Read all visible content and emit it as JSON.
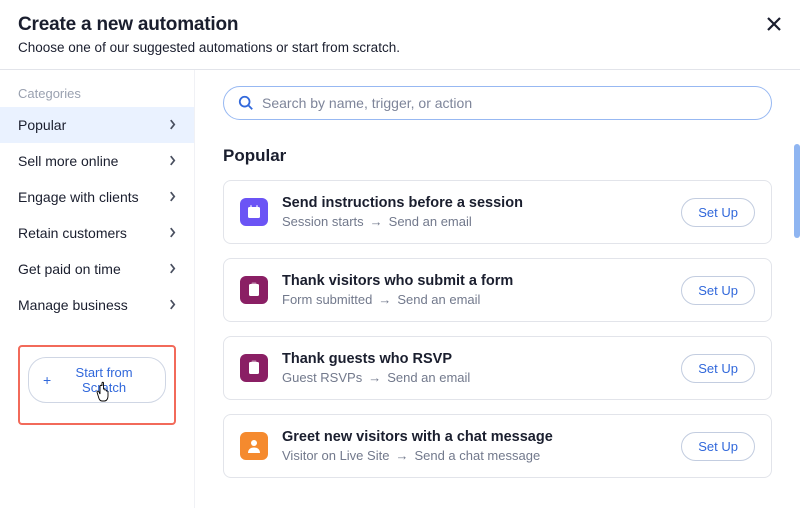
{
  "header": {
    "title": "Create a new automation",
    "subtitle": "Choose one of our suggested automations or start from scratch."
  },
  "sidebar": {
    "header": "Categories",
    "items": [
      {
        "label": "Popular",
        "active": true
      },
      {
        "label": "Sell more online"
      },
      {
        "label": "Engage with clients"
      },
      {
        "label": "Retain customers"
      },
      {
        "label": "Get paid on time"
      },
      {
        "label": "Manage business"
      }
    ],
    "scratch_label": "Start from Scratch"
  },
  "search": {
    "placeholder": "Search by name, trigger, or action",
    "value": ""
  },
  "section": {
    "title": "Popular"
  },
  "cards": [
    {
      "title": "Send instructions before a session",
      "trigger": "Session starts",
      "action": "Send an email",
      "setup": "Set Up",
      "color": "#6b54f5",
      "icon": "calendar"
    },
    {
      "title": "Thank visitors who submit a form",
      "trigger": "Form submitted",
      "action": "Send an email",
      "setup": "Set Up",
      "color": "#8a1f64",
      "icon": "clipboard"
    },
    {
      "title": "Thank guests who RSVP",
      "trigger": "Guest RSVPs",
      "action": "Send an email",
      "setup": "Set Up",
      "color": "#8a1f64",
      "icon": "clipboard"
    },
    {
      "title": "Greet new visitors with a chat message",
      "trigger": "Visitor on Live Site",
      "action": "Send a chat message",
      "setup": "Set Up",
      "color": "#f58a2e",
      "icon": "person"
    }
  ]
}
